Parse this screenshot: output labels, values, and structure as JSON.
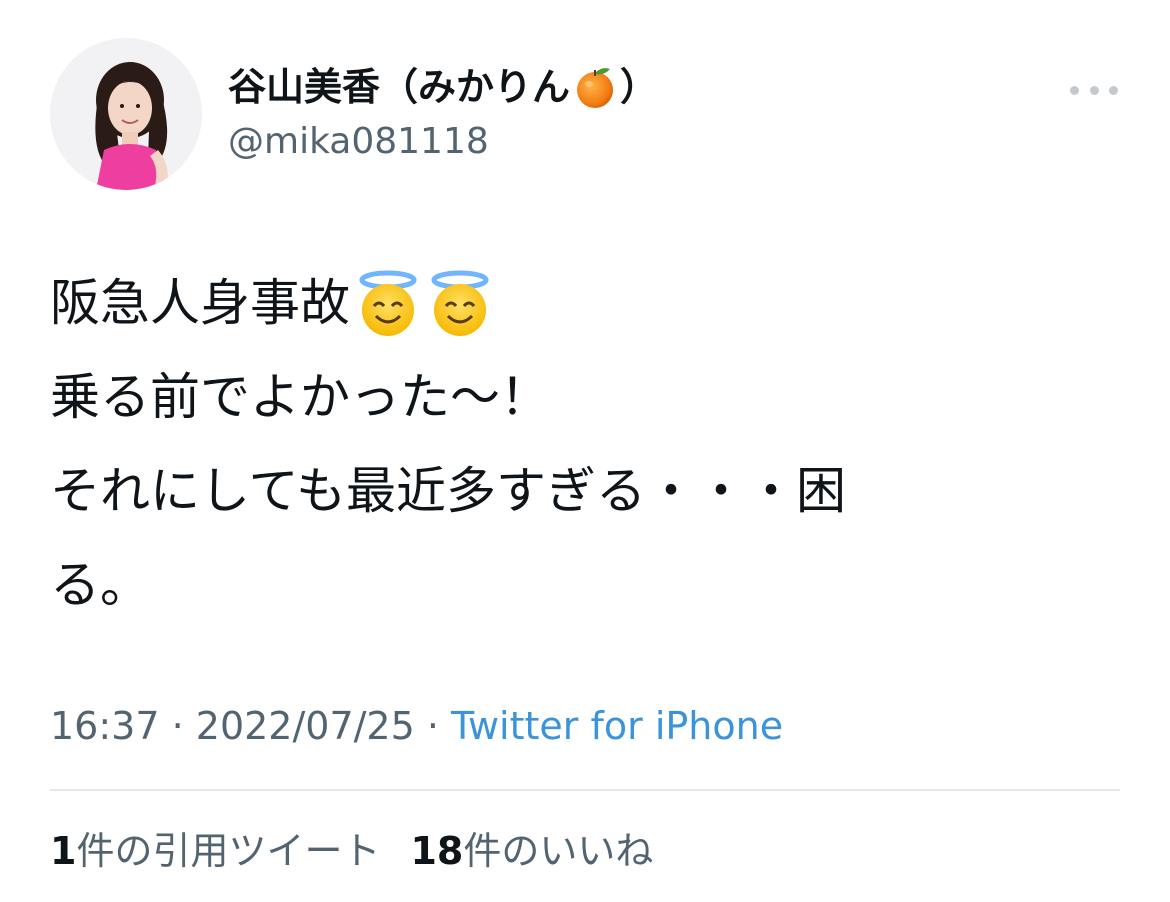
{
  "author": {
    "display_name_prefix": "谷山美香（みかりん",
    "display_name_emoji": "tangerine-icon",
    "display_name_suffix": "）",
    "handle": "@mika081118",
    "avatar": "profile-photo"
  },
  "tweet": {
    "line1_text": "阪急人身事故",
    "line1_emoji": "smiling-face-with-halo-icon",
    "line2": "乗る前でよかった〜！",
    "line3": "それにしても最近多すぎる・・・困",
    "line4": "る。"
  },
  "meta": {
    "time": "16:37",
    "separator1": " · ",
    "date": "2022/07/25",
    "separator2": " · ",
    "source": "Twitter for iPhone"
  },
  "stats": {
    "quote_count": "1",
    "quote_label": "件の引用ツイート",
    "like_count": "18",
    "like_label": "件のいいね"
  },
  "colors": {
    "text": "#0f1419",
    "secondary": "#536471",
    "link": "#3b94d9",
    "divider": "#e4e8eb"
  }
}
